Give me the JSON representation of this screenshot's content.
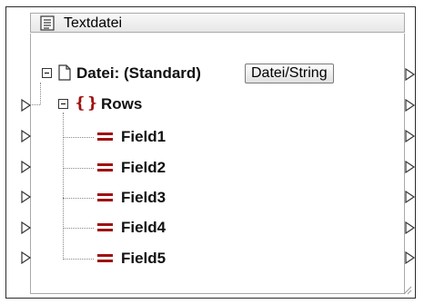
{
  "component": {
    "title": "Textdatei",
    "title_icon": "text-file-icon",
    "file_row": {
      "label": "Datei: (Standard)",
      "button_label": "Datei/String",
      "icon": "file-icon"
    },
    "rows_node": {
      "label": "Rows",
      "icon": "braces-icon"
    },
    "fields": [
      {
        "label": "Field1",
        "icon": "field-icon"
      },
      {
        "label": "Field2",
        "icon": "field-icon"
      },
      {
        "label": "Field3",
        "icon": "field-icon"
      },
      {
        "label": "Field4",
        "icon": "field-icon"
      },
      {
        "label": "Field5",
        "icon": "field-icon"
      }
    ],
    "colors": {
      "accent": "#a01010",
      "border": "#2b2b2b"
    }
  }
}
